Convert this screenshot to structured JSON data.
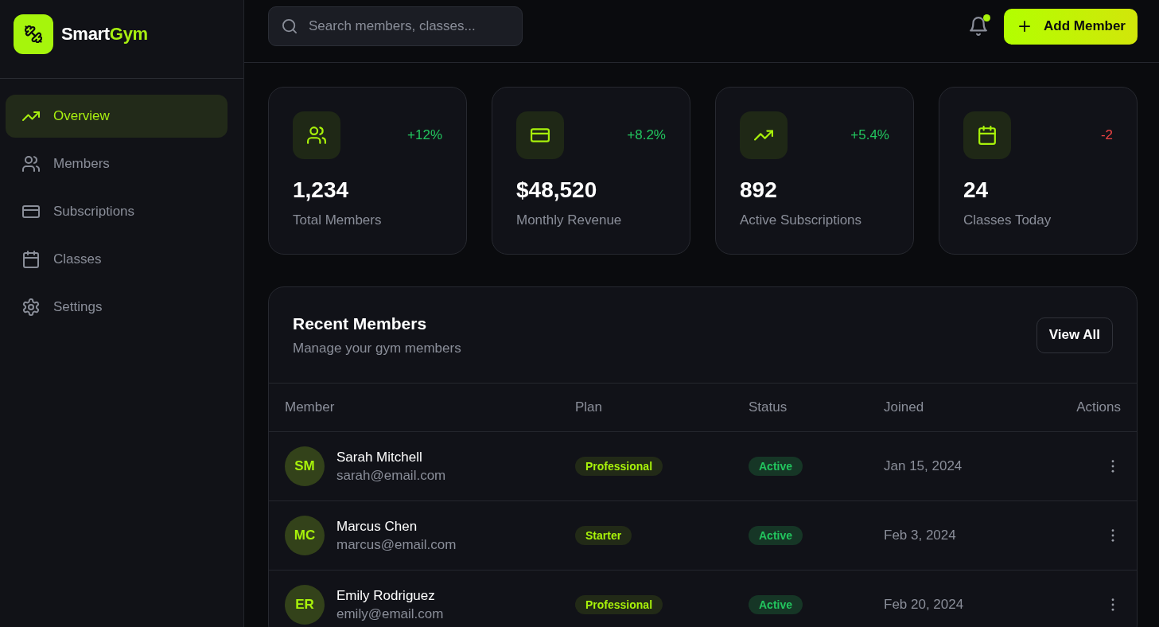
{
  "sidebar": {
    "brand": {
      "text": "Smart",
      "accent": "Gym"
    },
    "items": [
      {
        "label": "Overview",
        "selected": true
      },
      {
        "label": "Members",
        "selected": false
      },
      {
        "label": "Subscriptions",
        "selected": false
      },
      {
        "label": "Classes",
        "selected": false
      },
      {
        "label": "Settings",
        "selected": false
      }
    ]
  },
  "topbar": {
    "search": {
      "placeholder": "Search members, classes..."
    },
    "notifications": {
      "unread": true
    },
    "primary_button": {
      "label": "Add Member"
    }
  },
  "stats": [
    {
      "value": "1,234",
      "label": "Total Members",
      "change": "+12%",
      "increase": true
    },
    {
      "value": "$48,520",
      "label": "Monthly Revenue",
      "change": "+8.2%",
      "increase": true
    },
    {
      "value": "892",
      "label": "Active Subscriptions",
      "change": "+5.4%",
      "increase": true
    },
    {
      "value": "24",
      "label": "Classes Today",
      "change": "-2",
      "increase": false
    }
  ],
  "recent_members": {
    "title": "Recent Members",
    "subtitle": "Manage your gym members",
    "button": "View All",
    "table": {
      "columns": [
        "Member",
        "Plan",
        "Status",
        "Joined",
        "Actions"
      ],
      "rows": [
        {
          "initials": "SM",
          "name": "Sarah Mitchell",
          "email": "sarah@email.com",
          "plan": "Professional",
          "status": "Active",
          "joined": "Jan 15, 2024"
        },
        {
          "initials": "MC",
          "name": "Marcus Chen",
          "email": "marcus@email.com",
          "plan": "Starter",
          "status": "Active",
          "joined": "Feb 3, 2024"
        },
        {
          "initials": "ER",
          "name": "Emily Rodriguez",
          "email": "emily@email.com",
          "plan": "Professional",
          "status": "Active",
          "joined": "Feb 20, 2024"
        }
      ]
    }
  }
}
